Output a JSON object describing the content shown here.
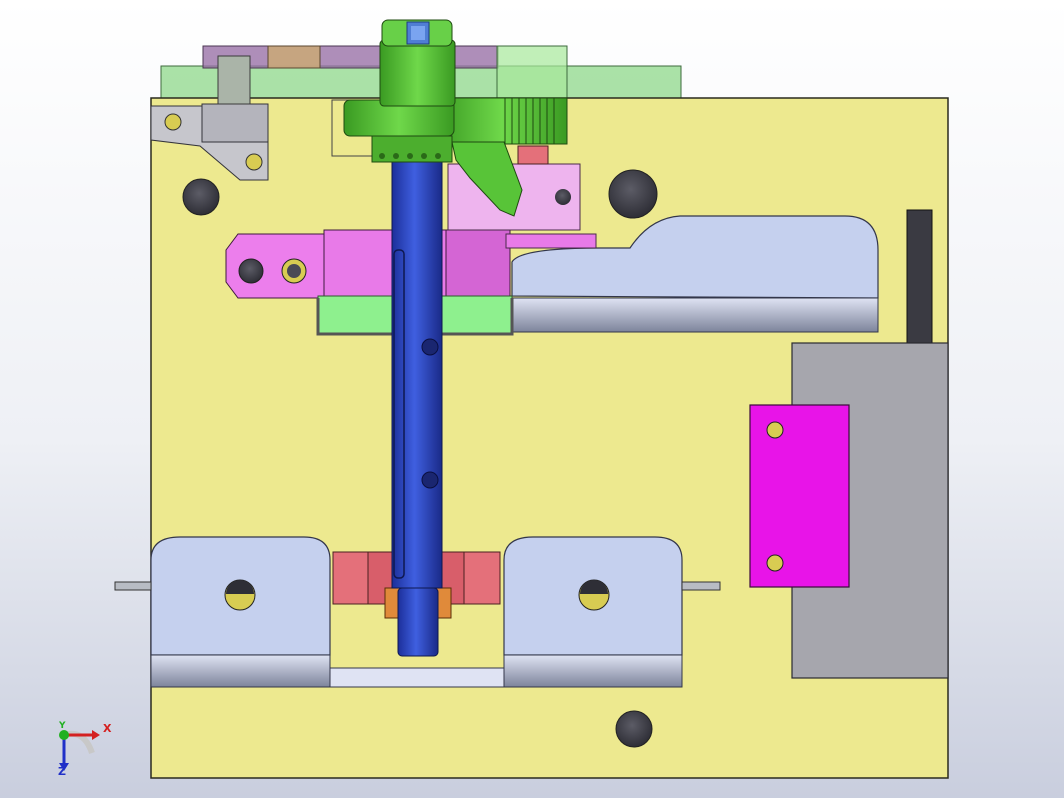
{
  "viewport": {
    "background_top": "#ffffff",
    "background_bottom": "#c9cede"
  },
  "model": {
    "base_plate_color": "#ede98f",
    "slider_color": "#c5d0ee",
    "gray_block_color": "#a6a6ad",
    "magenta_plate_color": "#e814e8",
    "pink_slider_color": "#ec7eec",
    "rose_block_color": "#e4707a",
    "shaft_color": "#2e47c8",
    "part_green": "#58c438",
    "light_green": "#7ee87e",
    "hole_color": "#4a4a55",
    "bolt_color": "#d8cc52"
  },
  "triad": {
    "x_label": "X",
    "y_label": "Y",
    "z_label": "Z",
    "x_color": "#d42020",
    "y_color": "#20b020",
    "z_color": "#2030c8"
  }
}
